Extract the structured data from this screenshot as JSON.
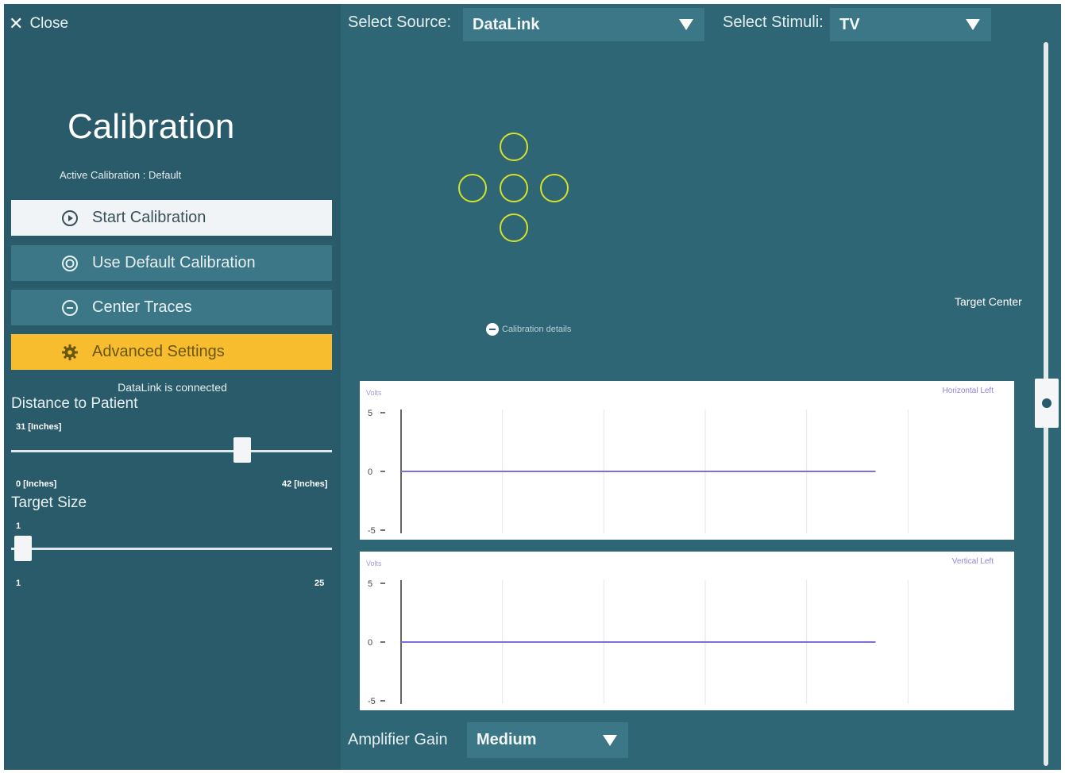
{
  "header": {
    "close_label": "Close",
    "source_label": "Select Source:",
    "source_value": "DataLink",
    "stimuli_label": "Select Stimuli:",
    "stimuli_value": "TV"
  },
  "sidebar": {
    "title": "Calibration",
    "active_calibration": "Active Calibration : Default",
    "buttons": [
      {
        "label": "Start Calibration",
        "icon": "play-circle-icon"
      },
      {
        "label": "Use Default Calibration",
        "icon": "target-icon"
      },
      {
        "label": "Center Traces",
        "icon": "center-icon"
      },
      {
        "label": "Advanced Settings",
        "icon": "gear-icon"
      }
    ],
    "status": "DataLink is connected",
    "distance": {
      "label": "Distance to Patient",
      "current": "31 [Inches]",
      "min": "0 [Inches]",
      "max": "42 [Inches]",
      "value": 31
    },
    "target_size": {
      "label": "Target Size",
      "current": "1",
      "min": "1",
      "max": "25",
      "value": 1
    }
  },
  "target_area": {
    "target_center_label": "Target Center",
    "calibration_details_label": "Calibration details"
  },
  "amplifier": {
    "label": "Amplifier Gain",
    "value": "Medium"
  },
  "colors": {
    "accent_yellow": "#f7bd2e",
    "panel": "#2a5b6a",
    "background": "#2f6676",
    "button": "#3b7787",
    "trace": "#7b6fe0",
    "circle": "#d5e22b"
  },
  "chart_data": [
    {
      "type": "line",
      "title": "Horizontal Left",
      "ylabel": "Volts",
      "ylim": [
        -5,
        5
      ],
      "yticks": [
        "5",
        "0",
        "-5"
      ],
      "series": [
        {
          "x": [
            0,
            0.78
          ],
          "values": [
            0,
            0
          ]
        }
      ]
    },
    {
      "type": "line",
      "title": "Vertical Left",
      "ylabel": "Volts",
      "ylim": [
        -5,
        5
      ],
      "yticks": [
        "5",
        "0",
        "-5"
      ],
      "series": [
        {
          "x": [
            0,
            0.78
          ],
          "values": [
            0,
            0
          ]
        }
      ]
    }
  ]
}
